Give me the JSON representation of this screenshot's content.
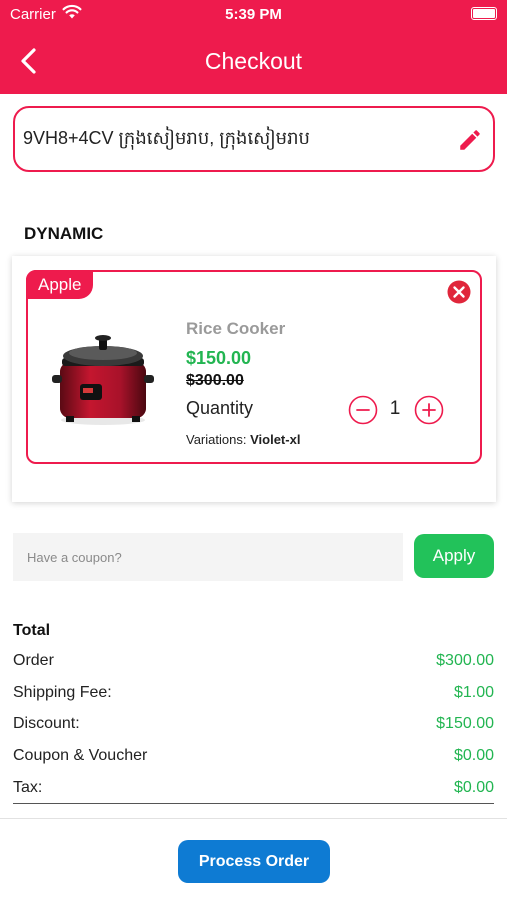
{
  "status_bar": {
    "carrier": "Carrier",
    "time": "5:39 PM"
  },
  "nav": {
    "title": "Checkout"
  },
  "address": {
    "text": "9VH8+4CV ក្រុងសៀមរាប, ក្រុងសៀមរាប"
  },
  "store": {
    "name": "DYNAMIC",
    "item": {
      "brand": "Apple",
      "name": "Rice Cooker",
      "price": "$150.00",
      "old_price": "$300.00",
      "quantity_label": "Quantity",
      "quantity": "1",
      "variations_label": "Variations:",
      "variations_value": "Violet-xl"
    }
  },
  "coupon": {
    "placeholder": "Have a coupon?",
    "apply_label": "Apply"
  },
  "totals": {
    "title": "Total",
    "rows": [
      {
        "label": "Order",
        "value": "$300.00"
      },
      {
        "label": "Shipping Fee:",
        "value": "$1.00"
      },
      {
        "label": "Discount:",
        "value": "$150.00"
      },
      {
        "label": "Coupon & Voucher",
        "value": "$0.00"
      },
      {
        "label": "Tax:",
        "value": "$0.00"
      }
    ]
  },
  "footer": {
    "process_label": "Process Order"
  },
  "colors": {
    "primary": "#ee1b4d",
    "success": "#22b551",
    "button_blue": "#0e7bd3"
  },
  "icons": [
    "wifi-icon",
    "battery-icon",
    "back-arrow-icon",
    "edit-pencil-icon",
    "remove-icon",
    "minus-icon",
    "plus-icon"
  ]
}
